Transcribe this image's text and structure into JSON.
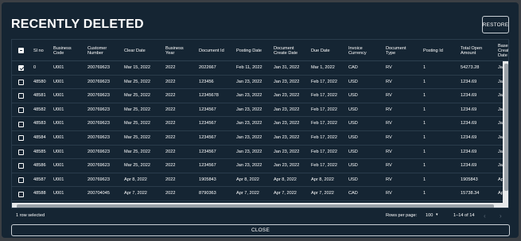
{
  "dialog": {
    "title": "RECENTLY DELETED",
    "restore_label": "RESTORE",
    "close_label": "CLOSE"
  },
  "table": {
    "columns": [
      "Sl no",
      "Business\nCode",
      "Customer\nNumber",
      "Clear Date",
      "Business\nYear",
      "Document Id",
      "Posting Date",
      "Document\nCreate Date",
      "Due Date",
      "Invoice\nCurrency",
      "Document\nType",
      "Posting Id",
      "Total Open\nAmount",
      "Baseline\nCreate Date"
    ],
    "rows": [
      {
        "checked": true,
        "cells": [
          "0",
          "U001",
          "200769623",
          "Mar 15, 2022",
          "2022",
          "2022667",
          "Feb 11, 2022",
          "Jan 31, 2022",
          "Mar 1, 2022",
          "CAD",
          "RV",
          "1",
          "54273.28",
          "Jan"
        ]
      },
      {
        "checked": false,
        "cells": [
          "48580",
          "U001",
          "200769623",
          "Mar 25, 2022",
          "2022",
          "123456",
          "Jan 23, 2022",
          "Jan 23, 2022",
          "Feb 17, 2022",
          "USD",
          "RV",
          "1",
          "1234.69",
          "Jan"
        ]
      },
      {
        "checked": false,
        "cells": [
          "48581",
          "U001",
          "200769623",
          "Mar 25, 2022",
          "2022",
          "12345678",
          "Jan 23, 2022",
          "Jan 23, 2022",
          "Feb 17, 2022",
          "USD",
          "RV",
          "1",
          "1234.69",
          "Jan"
        ]
      },
      {
        "checked": false,
        "cells": [
          "48582",
          "U001",
          "200769623",
          "Mar 25, 2022",
          "2022",
          "1234567",
          "Jan 23, 2022",
          "Jan 23, 2022",
          "Feb 17, 2022",
          "USD",
          "RV",
          "1",
          "1234.69",
          "Jan"
        ]
      },
      {
        "checked": false,
        "cells": [
          "48583",
          "U001",
          "200769623",
          "Mar 25, 2022",
          "2022",
          "1234567",
          "Jan 23, 2022",
          "Jan 23, 2022",
          "Feb 17, 2022",
          "USD",
          "RV",
          "1",
          "1234.69",
          "Jan"
        ]
      },
      {
        "checked": false,
        "cells": [
          "48584",
          "U001",
          "200769623",
          "Mar 25, 2022",
          "2022",
          "1234567",
          "Jan 23, 2022",
          "Jan 23, 2022",
          "Feb 17, 2022",
          "USD",
          "RV",
          "1",
          "1234.69",
          "Jan"
        ]
      },
      {
        "checked": false,
        "cells": [
          "48585",
          "U001",
          "200769623",
          "Mar 25, 2022",
          "2022",
          "1234567",
          "Jan 23, 2022",
          "Jan 23, 2022",
          "Feb 17, 2022",
          "USD",
          "RV",
          "1",
          "1234.69",
          "Jan"
        ]
      },
      {
        "checked": false,
        "cells": [
          "48586",
          "U001",
          "200769623",
          "Mar 25, 2022",
          "2022",
          "1234567",
          "Jan 23, 2022",
          "Jan 23, 2022",
          "Feb 17, 2022",
          "USD",
          "RV",
          "1",
          "1234.69",
          "Jan"
        ]
      },
      {
        "checked": false,
        "cells": [
          "48587",
          "U001",
          "200769623",
          "Apr 8, 2022",
          "2022",
          "1905843",
          "Apr 8, 2022",
          "Apr 8, 2022",
          "Apr 8, 2022",
          "USD",
          "RV",
          "1",
          "1905843",
          "Apr"
        ]
      },
      {
        "checked": false,
        "cells": [
          "48588",
          "U001",
          "200704045",
          "Apr 7, 2022",
          "2022",
          "8790363",
          "Apr 7, 2022",
          "Apr 7, 2022",
          "Apr 7, 2022",
          "CAD",
          "RV",
          "1",
          "15738.34",
          "Apr"
        ]
      }
    ]
  },
  "footer": {
    "selected_text": "1 row selected",
    "rows_per_page_label": "Rows per page:",
    "rows_per_page_value": "100",
    "range_text": "1–14 of 14",
    "prev_icon": "chevron-left-icon",
    "next_icon": "chevron-right-icon"
  },
  "colors": {
    "background": "#152533",
    "text": "#ffffff",
    "border": "#c9d0d6"
  }
}
